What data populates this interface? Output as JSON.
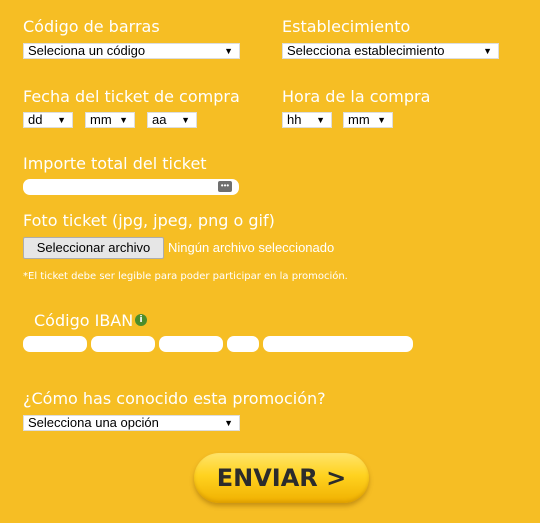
{
  "barcode": {
    "label": "Código de barras",
    "selected": "Seleciona un código"
  },
  "store": {
    "label": "Establecimiento",
    "selected": "Selecciona establecimiento"
  },
  "ticket_date": {
    "label": "Fecha del ticket de compra",
    "day": "dd",
    "month": "mm",
    "year": "aa"
  },
  "purchase_time": {
    "label": "Hora de la compra",
    "hour": "hh",
    "minute": "mm"
  },
  "total_amount": {
    "label": "Importe total del ticket",
    "value": ""
  },
  "photo": {
    "label": "Foto ticket (jpg, jpeg, png o gif)",
    "button": "Seleccionar archivo",
    "status": "Ningún archivo seleccionado",
    "note": "*El ticket debe ser legible para poder participar en la promoción."
  },
  "iban": {
    "label": "Código IBAN",
    "info_icon": "i"
  },
  "referral": {
    "label": "¿Cómo has conocido esta promoción?",
    "selected": "Selecciona una opción"
  },
  "submit": {
    "label": "ENVIAR >"
  },
  "icons": {
    "dropdown": "▼",
    "spinner": "•••"
  },
  "colors": {
    "background": "#f6be24",
    "info": "#4c8d2b",
    "button": "#ffd21f"
  }
}
